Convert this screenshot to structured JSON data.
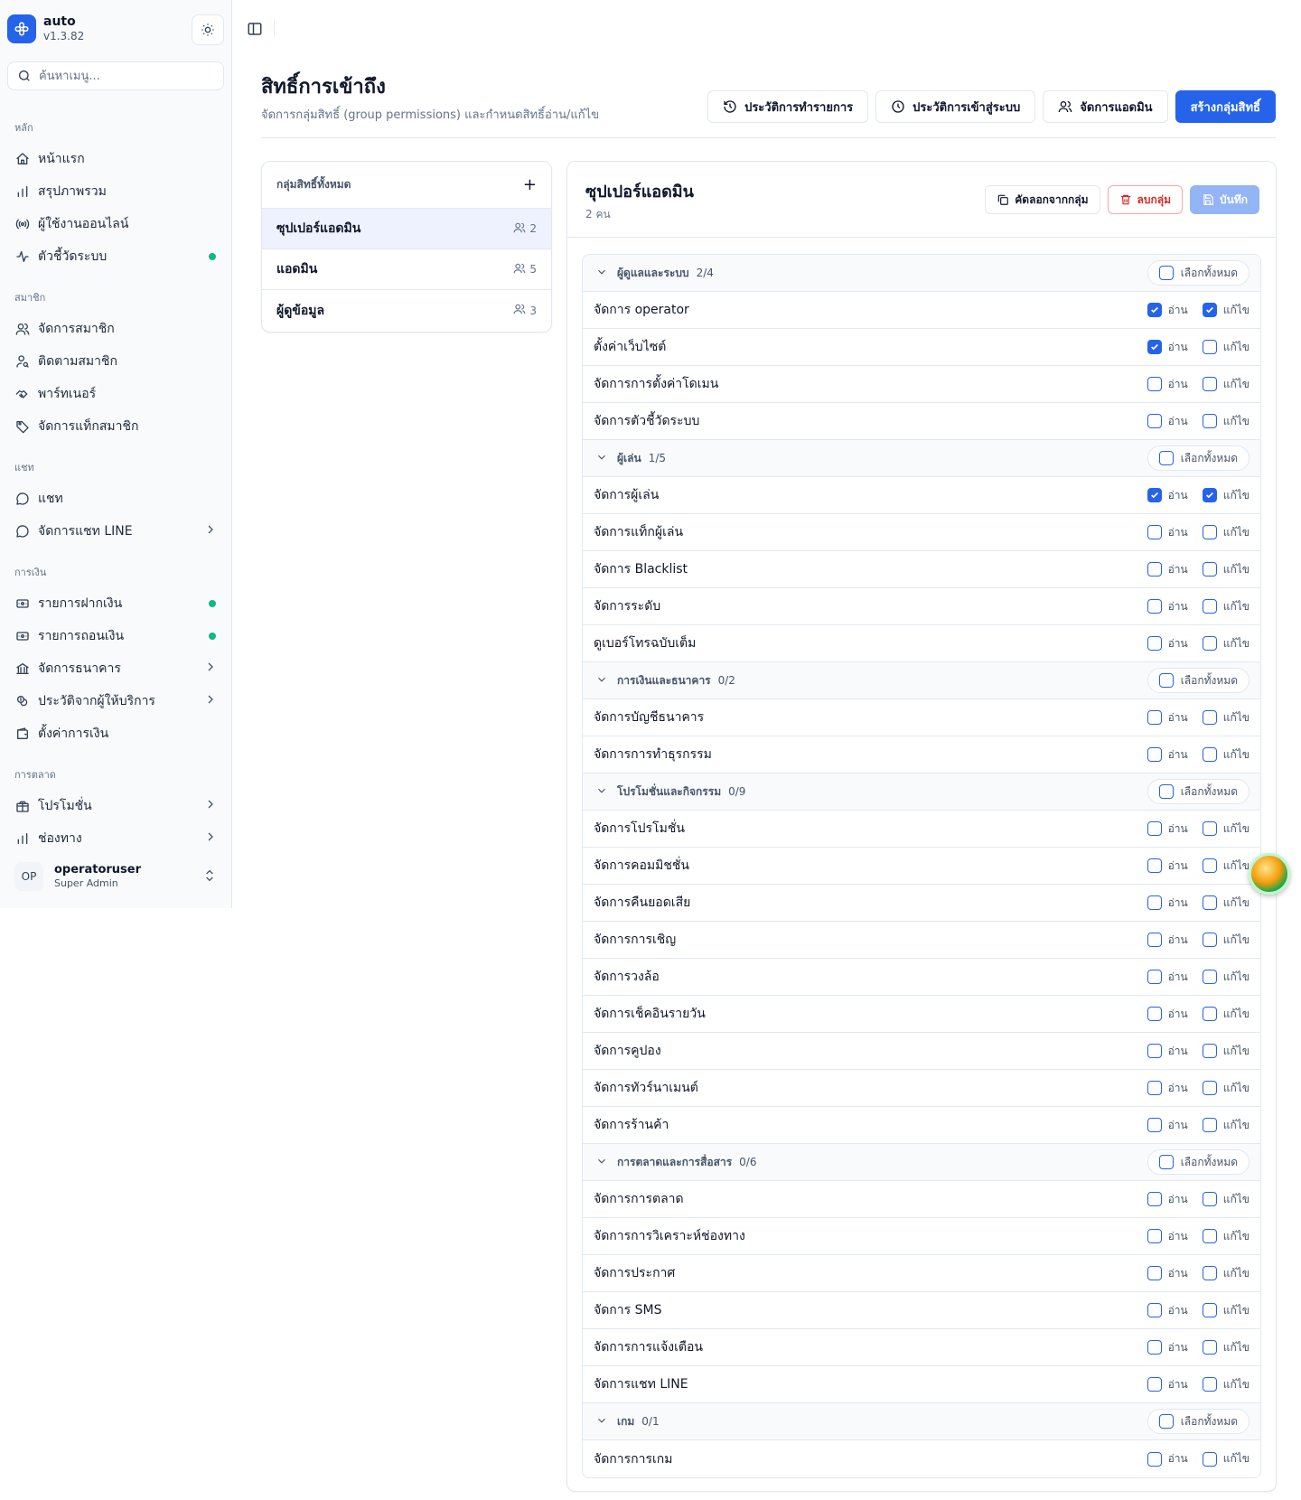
{
  "app": {
    "name": "auto",
    "version": "v1.3.82"
  },
  "search": {
    "placeholder": "ค้นหาเมนู..."
  },
  "sidebar": {
    "groups": [
      {
        "label": "หลัก",
        "items": [
          {
            "label": "หน้าแรก",
            "icon": "home-icon"
          },
          {
            "label": "สรุปภาพรวม",
            "icon": "bar-chart-icon"
          },
          {
            "label": "ผู้ใช้งานออนไลน์",
            "icon": "radio-icon"
          },
          {
            "label": "ตัวชี้วัดระบบ",
            "icon": "activity-icon",
            "status": "online"
          }
        ]
      },
      {
        "label": "สมาชิก",
        "items": [
          {
            "label": "จัดการสมาชิก",
            "icon": "users-icon"
          },
          {
            "label": "ติดตามสมาชิก",
            "icon": "user-search-icon"
          },
          {
            "label": "พาร์ทเนอร์",
            "icon": "handshake-icon"
          },
          {
            "label": "จัดการแท็กสมาชิก",
            "icon": "tag-icon"
          }
        ]
      },
      {
        "label": "แชท",
        "items": [
          {
            "label": "แชท",
            "icon": "message-circle-icon"
          },
          {
            "label": "จัดการแชท LINE",
            "icon": "message-circle-icon",
            "expandable": true
          }
        ]
      },
      {
        "label": "การเงิน",
        "items": [
          {
            "label": "รายการฝากเงิน",
            "icon": "deposit-icon",
            "status": "online"
          },
          {
            "label": "รายการถอนเงิน",
            "icon": "withdraw-icon",
            "status": "online"
          },
          {
            "label": "จัดการธนาคาร",
            "icon": "bank-icon",
            "expandable": true
          },
          {
            "label": "ประวัติจากผู้ให้บริการ",
            "icon": "coins-icon",
            "expandable": true
          },
          {
            "label": "ตั้งค่าการเงิน",
            "icon": "wallet-icon"
          }
        ]
      },
      {
        "label": "การตลาด",
        "items": [
          {
            "label": "โปรโมชั่น",
            "icon": "gift-icon",
            "expandable": true
          },
          {
            "label": "ช่องทาง",
            "icon": "bar-chart-icon",
            "expandable": true
          }
        ]
      }
    ],
    "user": {
      "initials": "OP",
      "name": "operatoruser",
      "role": "Super Admin"
    }
  },
  "header": {
    "title": "สิทธิ์การเข้าถึง",
    "subtitle": "จัดการกลุ่มสิทธิ์ (group permissions) และกำหนดสิทธิ์อ่าน/แก้ไข",
    "buttons": {
      "tx_history": "ประวัติการทำรายการ",
      "login_history": "ประวัติการเข้าสู่ระบบ",
      "manage_admins": "จัดการแอดมิน",
      "create_group": "สร้างกลุ่มสิทธิ์"
    }
  },
  "groups_panel": {
    "title": "กลุ่มสิทธิ์ทั้งหมด",
    "add_label": "+",
    "groups": [
      {
        "name": "ซุปเปอร์แอดมิน",
        "count": "2",
        "active": true
      },
      {
        "name": "แอดมิน",
        "count": "5",
        "active": false
      },
      {
        "name": "ผู้ดูข้อมูล",
        "count": "3",
        "active": false
      }
    ]
  },
  "detail": {
    "title": "ซุปเปอร์แอดมิน",
    "subtitle": "2 คน",
    "buttons": {
      "copy": "คัดลอกจากกลุ่ม",
      "delete": "ลบกลุ่ม",
      "save": "บันทึก"
    },
    "read_label": "อ่าน",
    "edit_label": "แก้ไข",
    "select_all_label": "เลือกทั้งหมด",
    "sections": [
      {
        "title": "ผู้ดูแลและระบบ",
        "count": "2/4",
        "perms": [
          {
            "name": "จัดการ operator",
            "read": true,
            "edit": true
          },
          {
            "name": "ตั้งค่าเว็บไซต์",
            "read": true,
            "edit": false
          },
          {
            "name": "จัดการการตั้งค่าโดเมน",
            "read": false,
            "edit": false
          },
          {
            "name": "จัดการตัวชี้วัดระบบ",
            "read": false,
            "edit": false
          }
        ]
      },
      {
        "title": "ผู้เล่น",
        "count": "1/5",
        "perms": [
          {
            "name": "จัดการผู้เล่น",
            "read": true,
            "edit": true
          },
          {
            "name": "จัดการแท็กผู้เล่น",
            "read": false,
            "edit": false
          },
          {
            "name": "จัดการ Blacklist",
            "read": false,
            "edit": false
          },
          {
            "name": "จัดการระดับ",
            "read": false,
            "edit": false
          },
          {
            "name": "ดูเบอร์โทรฉบับเต็ม",
            "read": false,
            "edit": false
          }
        ]
      },
      {
        "title": "การเงินและธนาคาร",
        "count": "0/2",
        "perms": [
          {
            "name": "จัดการบัญชีธนาคาร",
            "read": false,
            "edit": false
          },
          {
            "name": "จัดการการทำธุรกรรม",
            "read": false,
            "edit": false
          }
        ]
      },
      {
        "title": "โปรโมชั่นและกิจกรรม",
        "count": "0/9",
        "perms": [
          {
            "name": "จัดการโปรโมชั่น",
            "read": false,
            "edit": false
          },
          {
            "name": "จัดการคอมมิชชั่น",
            "read": false,
            "edit": false
          },
          {
            "name": "จัดการคืนยอดเสีย",
            "read": false,
            "edit": false
          },
          {
            "name": "จัดการการเชิญ",
            "read": false,
            "edit": false
          },
          {
            "name": "จัดการวงล้อ",
            "read": false,
            "edit": false
          },
          {
            "name": "จัดการเช็คอินรายวัน",
            "read": false,
            "edit": false
          },
          {
            "name": "จัดการคูปอง",
            "read": false,
            "edit": false
          },
          {
            "name": "จัดการทัวร์นาเมนต์",
            "read": false,
            "edit": false
          },
          {
            "name": "จัดการร้านค้า",
            "read": false,
            "edit": false
          }
        ]
      },
      {
        "title": "การตลาดและการสื่อสาร",
        "count": "0/6",
        "perms": [
          {
            "name": "จัดการการตลาด",
            "read": false,
            "edit": false
          },
          {
            "name": "จัดการการวิเคราะห์ช่องทาง",
            "read": false,
            "edit": false
          },
          {
            "name": "จัดการประกาศ",
            "read": false,
            "edit": false
          },
          {
            "name": "จัดการ SMS",
            "read": false,
            "edit": false
          },
          {
            "name": "จัดการการแจ้งเตือน",
            "read": false,
            "edit": false
          },
          {
            "name": "จัดการแชท LINE",
            "read": false,
            "edit": false
          }
        ]
      },
      {
        "title": "เกม",
        "count": "0/1",
        "perms": [
          {
            "name": "จัดการการเกม",
            "read": false,
            "edit": false
          }
        ]
      }
    ]
  },
  "colors": {
    "accent": "#2563eb",
    "online": "#10b981",
    "danger": "#dc2626"
  }
}
